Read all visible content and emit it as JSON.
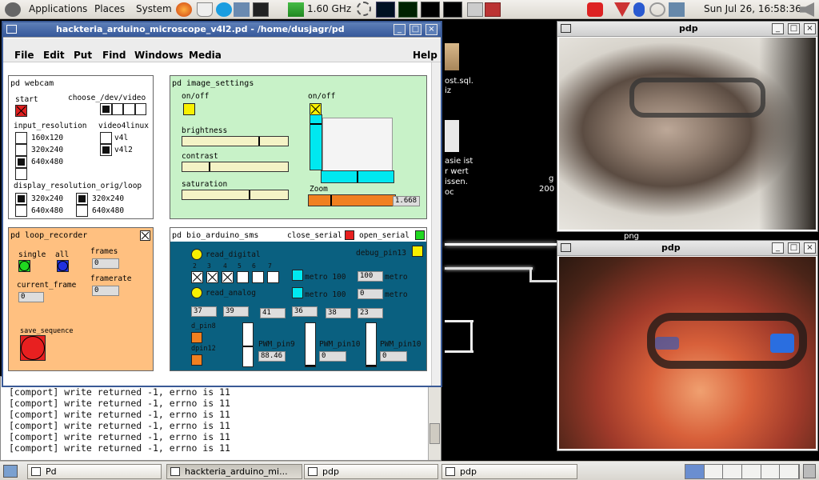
{
  "panel": {
    "applications": "Applications",
    "places": "Places",
    "system": "System",
    "cpu_freq": "1.60 GHz",
    "clock": "Sun Jul 26, 16:58:36"
  },
  "desktop": {
    "file1": "ost.sql.",
    "file1b": "iz",
    "file2a": "asie ist",
    "file2b": "r wert",
    "file2c": "issen.",
    "file2d": "oc",
    "file3a": "g",
    "file3b": "200",
    "file4": "png"
  },
  "pd_window": {
    "title": "hackteria_arduino_microscope_v4l2.pd  - /home/dusjagr/pd",
    "menu": [
      "File",
      "Edit",
      "Put",
      "Find",
      "Windows",
      "Media"
    ],
    "help": "Help",
    "webcam": {
      "header": "pd webcam",
      "start": "start",
      "choose": "choose_/dev/video",
      "input_res": "input_resolution",
      "v4l": "video4linux",
      "res1": "160x120",
      "res2": "320x240",
      "res3": "640x480",
      "opt1": "v4l",
      "opt2": "v4l2",
      "display_res": "display_resolution_orig/loop",
      "dres1": "320x240",
      "dres2": "640x480",
      "dres3": "320x240",
      "dres4": "640x480"
    },
    "image_settings": {
      "header": "pd image_settings",
      "onoff1": "on/off",
      "onoff2": "on/off",
      "brightness": "brightness",
      "contrast": "contrast",
      "saturation": "saturation",
      "zoom": "Zoom",
      "zoom_val": "1.668",
      "brightness_level": 0.72,
      "contrast_level": 0.25,
      "saturation_level": 0.63,
      "zoom_level": 0.25
    },
    "loop_recorder": {
      "header": "pd loop_recorder",
      "single": "single",
      "all": "all",
      "frames": "frames",
      "frames_val": "0",
      "framerate": "framerate",
      "framerate_val": "0",
      "current_frame": "current_frame",
      "current_val": "0",
      "save": "save_sequence"
    },
    "bio_arduino": {
      "header": "pd bio_arduino_sms",
      "close_serial": "close_serial",
      "open_serial": "open_serial",
      "debug": "debug_pin13",
      "read_digital": "read_digital",
      "read_analog": "read_analog",
      "pins": [
        "2",
        "3",
        "4",
        "5",
        "6",
        "7"
      ],
      "metro1": "metro 100",
      "metro2": "metro 100",
      "metro_n1": "100",
      "metro_l1": "metro",
      "metro_n2": "0",
      "metro_l2": "metro",
      "analog": [
        "37",
        "39",
        "41",
        "36",
        "38",
        "23"
      ],
      "d_pin8": "d_pin8",
      "dpin12": "dpin12",
      "pwm9": "PWM_pin9",
      "pwm9_val": "88.46",
      "pwm10a": "PWM_pin10",
      "pwm10a_val": "0",
      "pwm10b": "PWM_pin10",
      "pwm10b_val": "0"
    }
  },
  "console": {
    "lines": [
      "[comport] write returned -1, errno is 11",
      "[comport] write returned -1, errno is 11",
      "[comport] write returned -1, errno is 11",
      "[comport] write returned -1, errno is 11",
      "[comport] write returned -1, errno is 11",
      "[comport] write returned -1, errno is 11"
    ]
  },
  "pdp1": {
    "title": "pdp"
  },
  "pdp2": {
    "title": "pdp"
  },
  "taskbar": {
    "tasks": [
      "Pd",
      "hackteria_arduino_mi...",
      "pdp",
      "pdp"
    ]
  },
  "colors": {
    "image_panel": "#c8f2c8",
    "loop_panel": "#ffc080",
    "bio_panel": "#0a6080",
    "cyan": "#00e8f0",
    "orange": "#f08020",
    "red": "#e82020",
    "yellow": "#f8f000"
  }
}
